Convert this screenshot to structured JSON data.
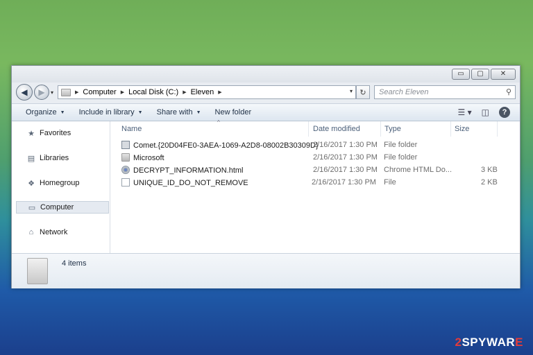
{
  "window": {
    "controls": {
      "minimize": "▭",
      "maximize": "▢",
      "close": "✕"
    }
  },
  "nav": {
    "back": "◀",
    "forward": "▶",
    "breadcrumb": [
      "Computer",
      "Local Disk (C:)",
      "Eleven"
    ],
    "refresh": "↻",
    "search_placeholder": "Search Eleven",
    "search_icon": "⚲"
  },
  "toolbar": {
    "organize": "Organize",
    "include": "Include in library",
    "share": "Share with",
    "new_folder": "New folder",
    "help": "?"
  },
  "sidebar": {
    "items": [
      {
        "label": "Favorites",
        "icon": "★"
      },
      {
        "label": "Libraries",
        "icon": "▤"
      },
      {
        "label": "Homegroup",
        "icon": "❖"
      },
      {
        "label": "Computer",
        "icon": "▭",
        "selected": true
      },
      {
        "label": "Network",
        "icon": "⌂"
      }
    ]
  },
  "columns": {
    "name": "Name",
    "date": "Date modified",
    "type": "Type",
    "size": "Size"
  },
  "files": [
    {
      "name": "Comet.{20D04FE0-3AEA-1069-A2D8-08002B30309D}",
      "date": "2/16/2017 1:30 PM",
      "type": "File folder",
      "size": "",
      "icon": "control-panel-icon"
    },
    {
      "name": "Microsoft",
      "date": "2/16/2017 1:30 PM",
      "type": "File folder",
      "size": "",
      "icon": "folder-icon"
    },
    {
      "name": "DECRYPT_INFORMATION.html",
      "date": "2/16/2017 1:30 PM",
      "type": "Chrome HTML Do...",
      "size": "3 KB",
      "icon": "chrome-icon"
    },
    {
      "name": "UNIQUE_ID_DO_NOT_REMOVE",
      "date": "2/16/2017 1:30 PM",
      "type": "File",
      "size": "2 KB",
      "icon": "file-icon"
    }
  ],
  "status": {
    "count": "4 items"
  },
  "watermark": {
    "prefix": "2",
    "text": "SPYWAR",
    "suffix": "E"
  }
}
